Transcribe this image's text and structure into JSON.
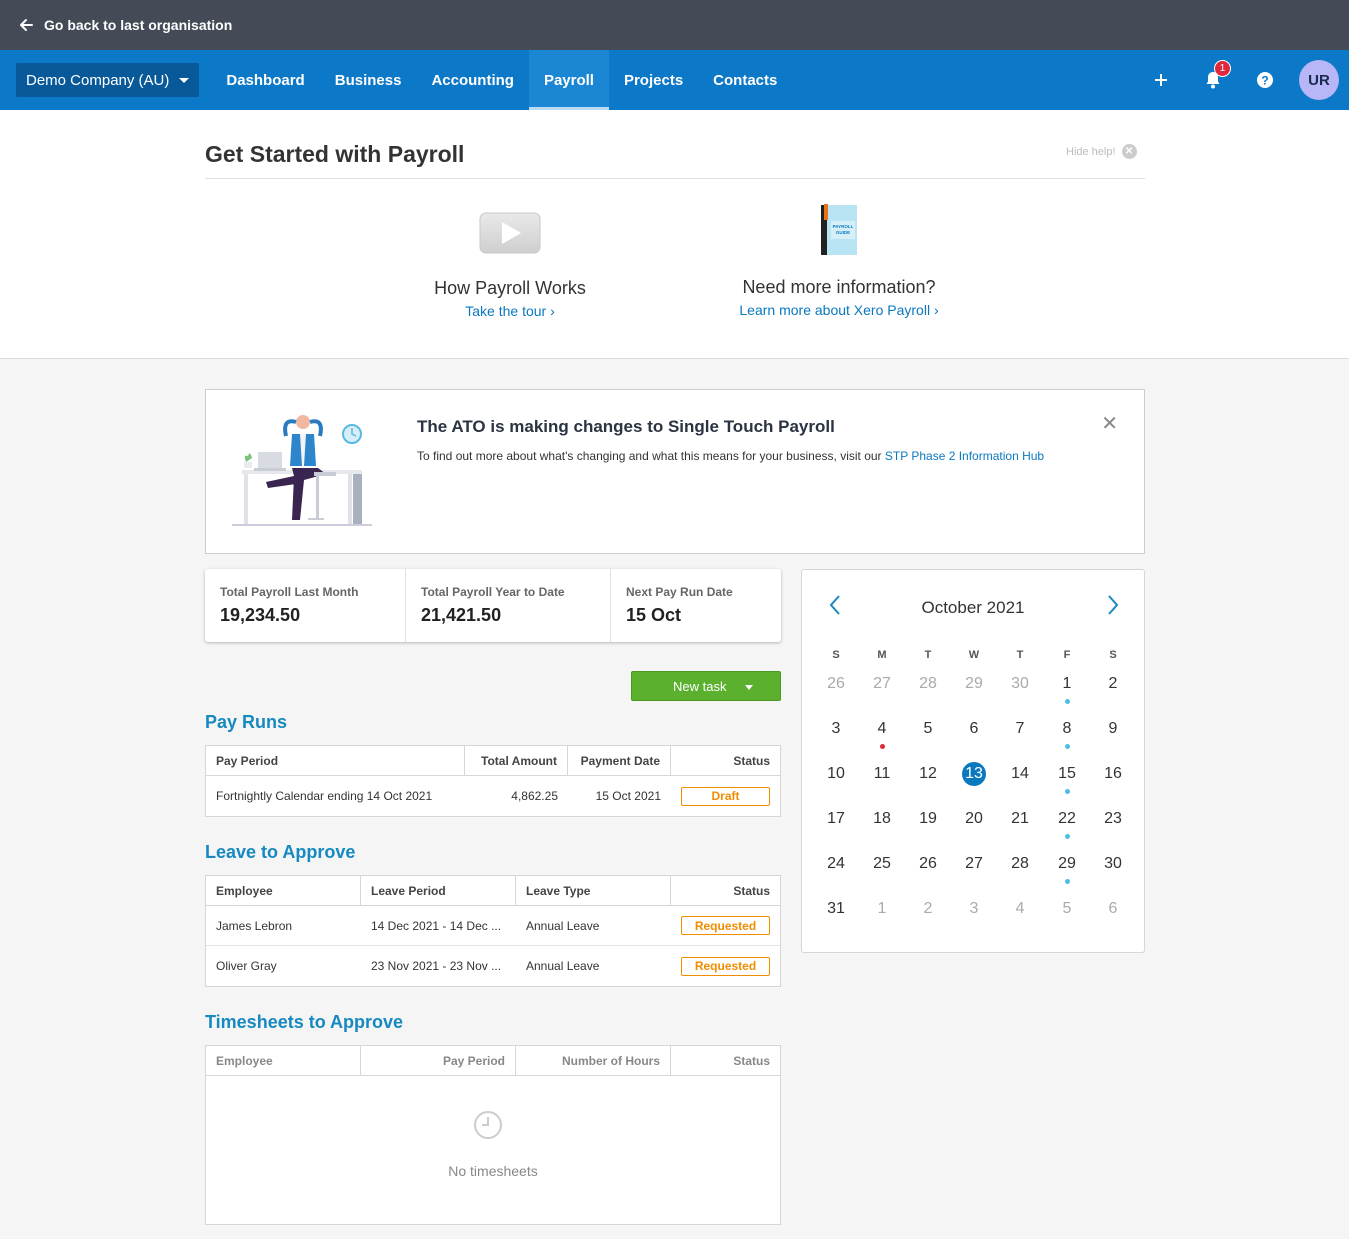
{
  "topbar": {
    "back_label": "Go back to last organisation"
  },
  "nav": {
    "org": "Demo Company (AU)",
    "items": [
      "Dashboard",
      "Business",
      "Accounting",
      "Payroll",
      "Projects",
      "Contacts"
    ],
    "active": "Payroll",
    "notification_count": "1",
    "avatar_initials": "UR"
  },
  "help": {
    "title": "Get Started with Payroll",
    "hide_label": "Hide help!",
    "card1": {
      "title": "How Payroll Works",
      "link": "Take the tour ›"
    },
    "card2": {
      "title": "Need more information?",
      "link": "Learn more about Xero Payroll ›",
      "book_text": "PAYROLL GUIDE"
    }
  },
  "banner": {
    "title": "The ATO is making changes to Single Touch Payroll",
    "text": "To find out more about what's changing and what this means for your business, visit our ",
    "link": "STP Phase 2 Information Hub"
  },
  "stats": [
    {
      "label": "Total Payroll Last Month",
      "value": "19,234.50"
    },
    {
      "label": "Total Payroll Year to Date",
      "value": "21,421.50"
    },
    {
      "label": "Next Pay Run Date",
      "value": "15 Oct"
    }
  ],
  "new_task_label": "New task",
  "pay_runs": {
    "title": "Pay Runs",
    "headers": [
      "Pay Period",
      "Total Amount",
      "Payment Date",
      "Status"
    ],
    "rows": [
      {
        "period": "Fortnightly Calendar ending 14 Oct 2021",
        "amount": "4,862.25",
        "date": "15 Oct 2021",
        "status": "Draft"
      }
    ]
  },
  "leave": {
    "title": "Leave to Approve",
    "headers": [
      "Employee",
      "Leave Period",
      "Leave Type",
      "Status"
    ],
    "rows": [
      {
        "employee": "James Lebron",
        "period": "14 Dec 2021 - 14 Dec ...",
        "type": "Annual Leave",
        "status": "Requested"
      },
      {
        "employee": "Oliver Gray",
        "period": "23 Nov 2021 - 23 Nov ...",
        "type": "Annual Leave",
        "status": "Requested"
      }
    ]
  },
  "timesheets": {
    "title": "Timesheets to Approve",
    "headers": [
      "Employee",
      "Pay Period",
      "Number of Hours",
      "Status"
    ],
    "empty": "No timesheets"
  },
  "calendar": {
    "month": "October 2021",
    "dow": [
      "S",
      "M",
      "T",
      "W",
      "T",
      "F",
      "S"
    ],
    "weeks": [
      [
        "26",
        "27",
        "28",
        "29",
        "30",
        "1",
        "2"
      ],
      [
        "3",
        "4",
        "5",
        "6",
        "7",
        "8",
        "9"
      ],
      [
        "10",
        "11",
        "12",
        "13",
        "14",
        "15",
        "16"
      ],
      [
        "17",
        "18",
        "19",
        "20",
        "21",
        "22",
        "23"
      ],
      [
        "24",
        "25",
        "26",
        "27",
        "28",
        "29",
        "30"
      ],
      [
        "31",
        "1",
        "2",
        "3",
        "4",
        "5",
        "6"
      ]
    ],
    "today": "13",
    "blue_dot_days": [
      "1",
      "8",
      "15",
      "22",
      "29"
    ],
    "red_dot_days": [
      "4"
    ],
    "accent": "#0a78bf"
  }
}
